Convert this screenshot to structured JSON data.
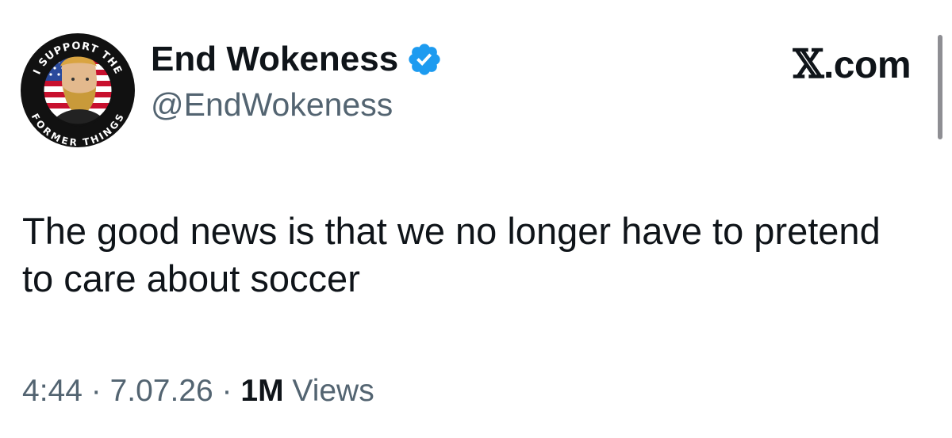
{
  "author": {
    "display_name": "End Wokeness",
    "handle": "@EndWokeness",
    "verified_icon": "verified-badge-icon",
    "avatar_top_text": "I SUPPORT THE",
    "avatar_bottom_text": "FORMER THINGS"
  },
  "brand": {
    "x_glyph": "𝕏",
    "suffix": ".com"
  },
  "post": {
    "text": "The good news is that we no longer have to pretend to care about soccer"
  },
  "meta": {
    "time": "4:44",
    "sep": " · ",
    "date": "7.07.26",
    "views_count": "1M",
    "views_label": " Views"
  },
  "colors": {
    "text": "#0f1419",
    "secondary": "#536471",
    "verified": "#1d9bf0"
  }
}
